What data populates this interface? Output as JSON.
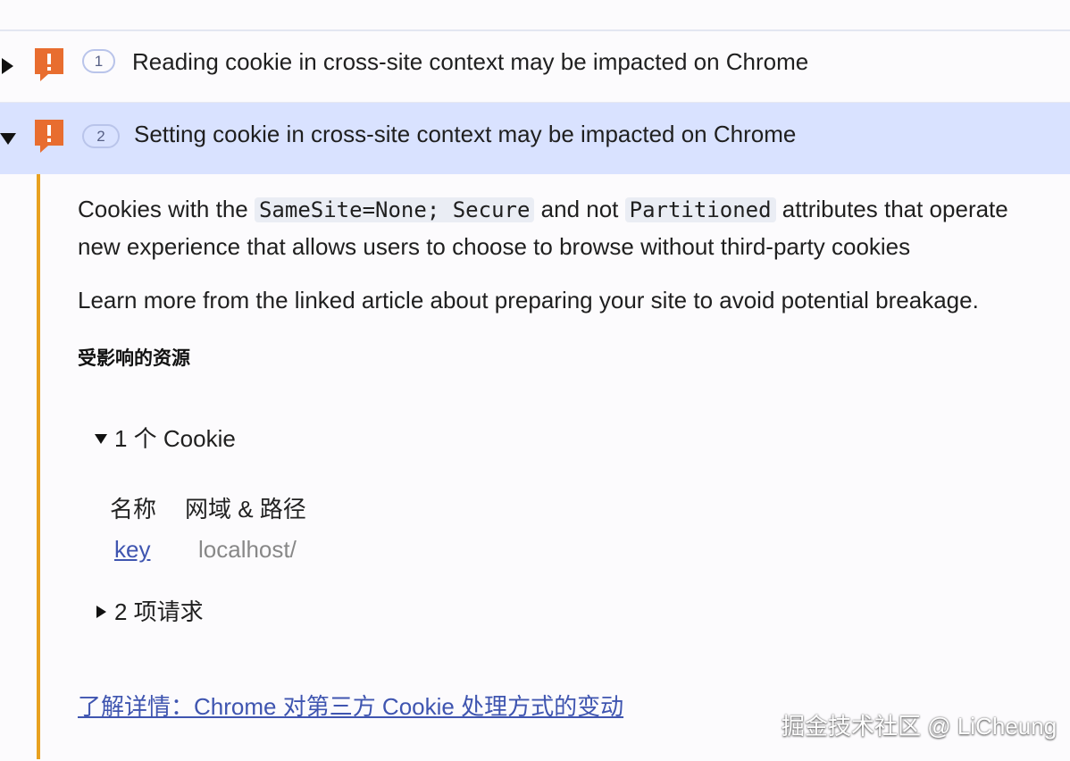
{
  "issues": [
    {
      "count": "1",
      "title": "Reading cookie in cross-site context may be impacted on Chrome",
      "expanded": false
    },
    {
      "count": "2",
      "title": "Setting cookie in cross-site context may be impacted on Chrome",
      "expanded": true
    }
  ],
  "details": {
    "paragraph1": {
      "prefix": "Cookies with the ",
      "code1": "SameSite=None; Secure",
      "middle": " and not ",
      "code2": "Partitioned",
      "suffix": " attributes that operate",
      "line2": "new experience that allows users to choose to browse without third-party cookies"
    },
    "paragraph2": "Learn more from the linked article about preparing your site to avoid potential breakage.",
    "affected_heading": "受影响的资源",
    "cookies_toggle": "1 个 Cookie",
    "cookie_table": {
      "header_name": "名称",
      "header_domain": "网域 & 路径",
      "rows": [
        {
          "name": "key",
          "domain": "localhost/"
        }
      ]
    },
    "requests_toggle": "2 项请求",
    "learn_more_link": "了解详情：Chrome 对第三方 Cookie 处理方式的变动"
  },
  "watermark": "掘金技术社区 @ LiCheung",
  "colors": {
    "warning_icon": "#e86d2f",
    "accent_bar": "#e8a120",
    "selected_row": "#d9e2ff",
    "link": "#3f55b0"
  },
  "icons": {
    "warning": "warning-speech-bubble-icon",
    "collapse": "triangle-right-icon",
    "expand": "triangle-down-icon"
  }
}
